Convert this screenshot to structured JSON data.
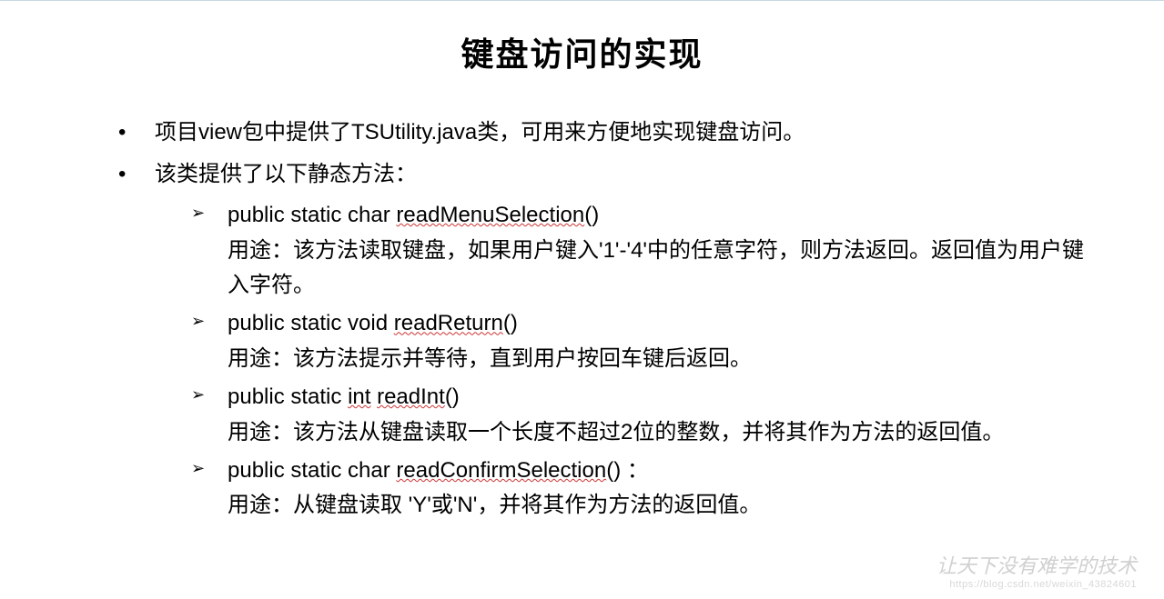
{
  "title": "键盘访问的实现",
  "bullets": {
    "item1": "项目view包中提供了TSUtility.java类，可用来方便地实现键盘访问。",
    "item2": "该类提供了以下静态方法：",
    "methods": [
      {
        "sig_prefix": "public static char ",
        "sig_name": "readMenuSelection",
        "sig_suffix": "()",
        "desc": "用途：该方法读取键盘，如果用户键入'1'-'4'中的任意字符，则方法返回。返回值为用户键入字符。"
      },
      {
        "sig_prefix": "public static void ",
        "sig_name": "readReturn",
        "sig_suffix": "()",
        "desc": "用途：该方法提示并等待，直到用户按回车键后返回。"
      },
      {
        "sig_prefix": "public static ",
        "sig_int": "int",
        "sig_space": " ",
        "sig_name": "readInt",
        "sig_suffix": "()",
        "desc": "用途：该方法从键盘读取一个长度不超过2位的整数，并将其作为方法的返回值。"
      },
      {
        "sig_prefix": "public static char ",
        "sig_name": "readConfirmSelection",
        "sig_suffix": "() ：",
        "desc": "用途：从键盘读取 'Y'或'N'，并将其作为方法的返回值。"
      }
    ]
  },
  "watermark": {
    "main": "让天下没有难学的技术",
    "sub": "https://blog.csdn.net/weixin_43824601"
  }
}
